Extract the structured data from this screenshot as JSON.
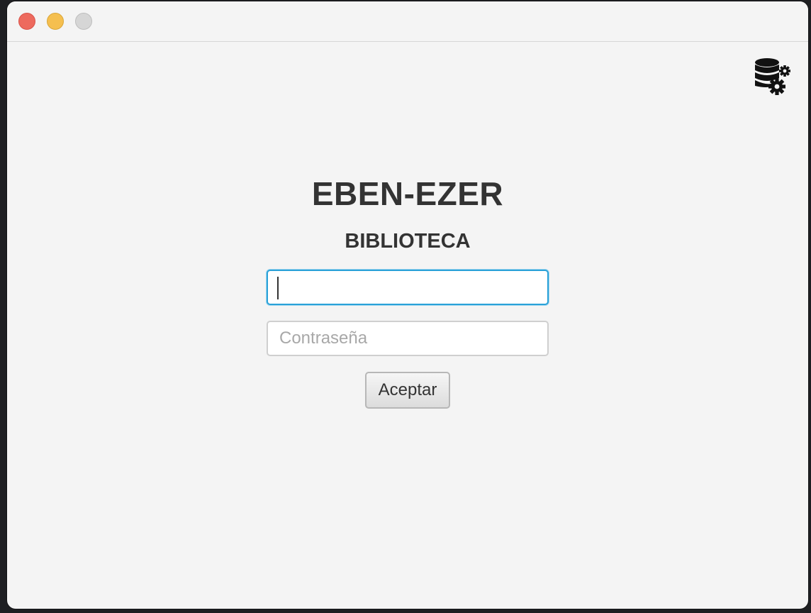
{
  "window": {
    "controls": {
      "close": {
        "icon": "close-dot-icon",
        "color": "#ed6a5e"
      },
      "minimize": {
        "icon": "minimize-dot-icon",
        "color": "#f5bf4f"
      },
      "zoom": {
        "icon": "zoom-dot-icon",
        "color": "#d6d6d6"
      }
    }
  },
  "toolbar": {
    "settings_icon": "database-settings-icon"
  },
  "login": {
    "title": "EBEN-EZER",
    "subtitle": "BIBLIOTECA",
    "username": {
      "value": "",
      "placeholder": ""
    },
    "password": {
      "value": "",
      "placeholder": "Contraseña"
    },
    "submit_label": "Aceptar"
  },
  "colors": {
    "focus_ring": "#2aa1d8",
    "text": "#333333",
    "background": "#f4f4f4"
  }
}
